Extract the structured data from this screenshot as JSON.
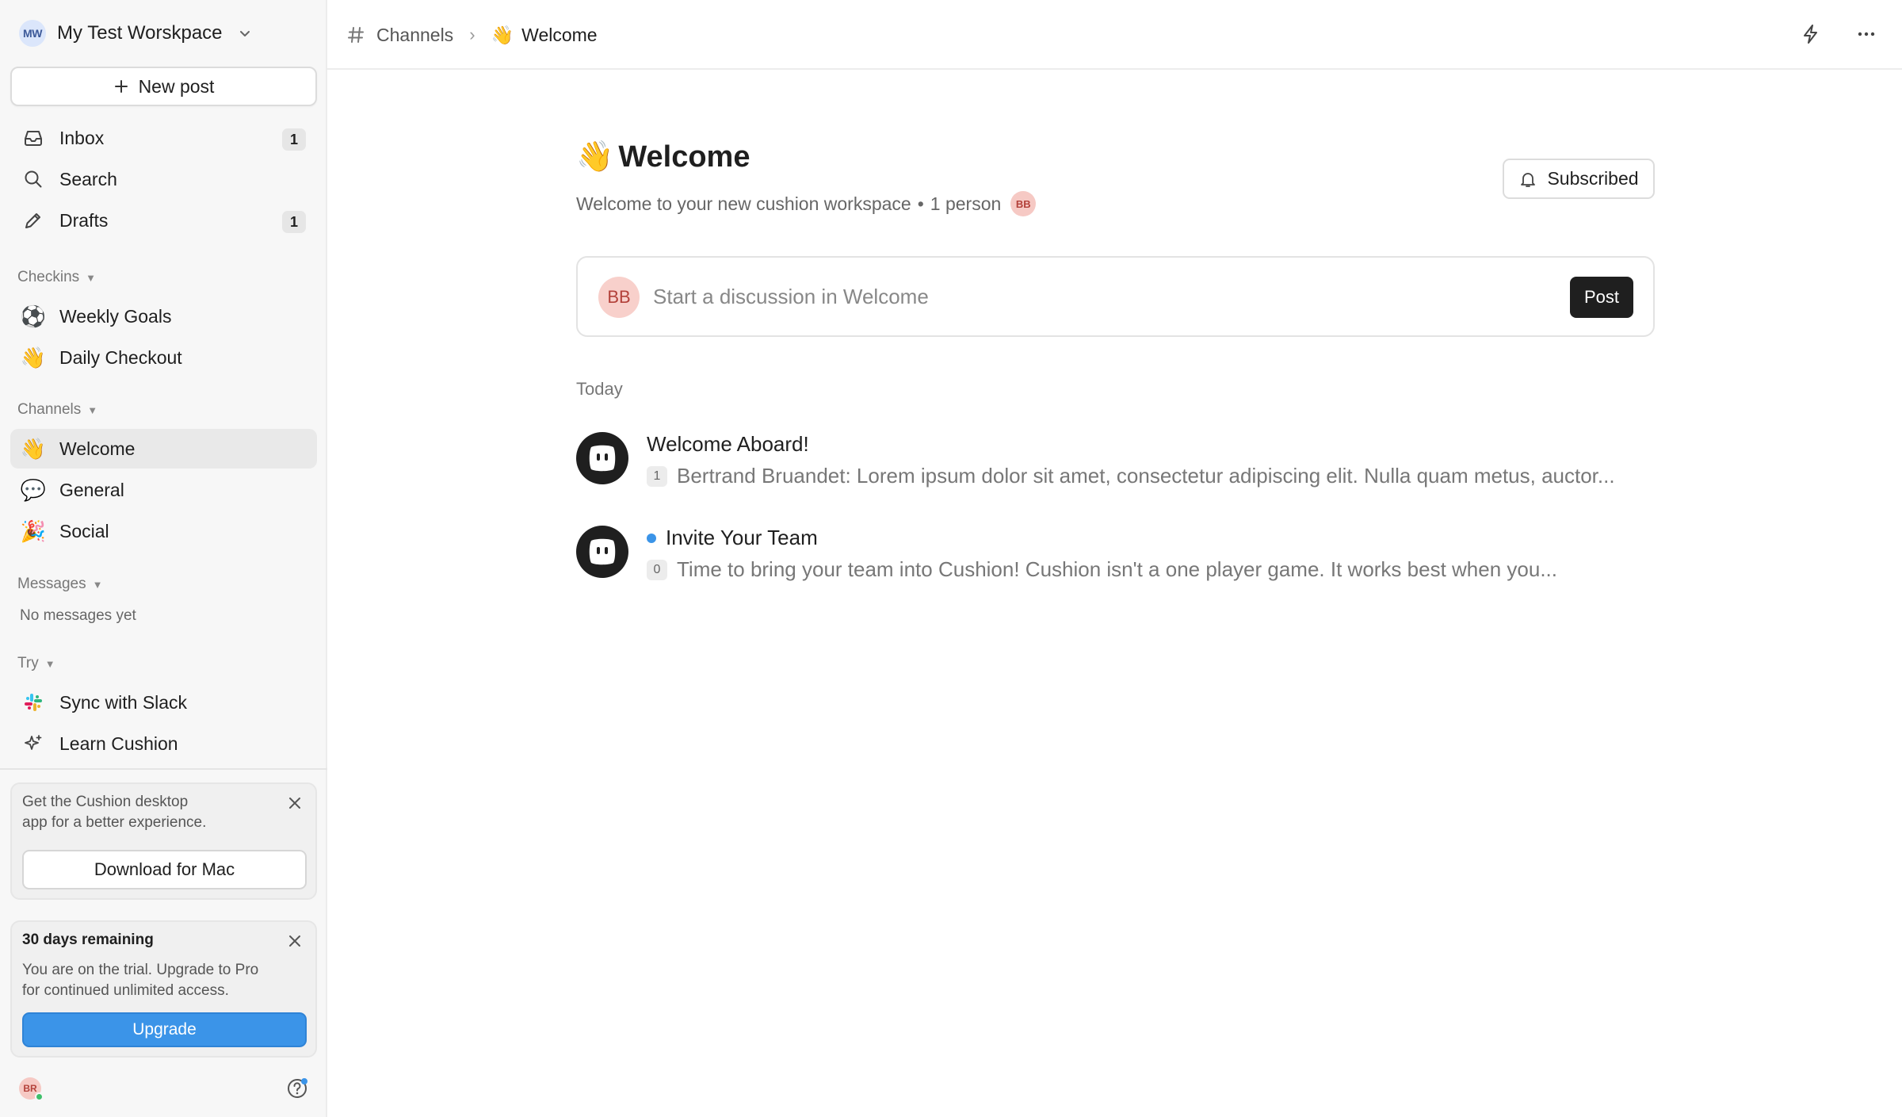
{
  "workspace": {
    "initials": "MW",
    "name": "My Test Worskpace"
  },
  "sidebar": {
    "new_post_label": "New post",
    "primary": [
      {
        "icon": "inbox-icon",
        "label": "Inbox",
        "badge": "1"
      },
      {
        "icon": "search-icon",
        "label": "Search"
      },
      {
        "icon": "pencil-icon",
        "label": "Drafts",
        "badge": "1"
      }
    ],
    "checkins_label": "Checkins",
    "checkins": [
      {
        "icon": "soccer-ball-icon",
        "emoji": "⚽",
        "label": "Weekly Goals"
      },
      {
        "icon": "waving-hand-icon",
        "emoji": "👋",
        "label": "Daily Checkout"
      }
    ],
    "channels_label": "Channels",
    "channels": [
      {
        "icon": "waving-hand-icon",
        "emoji": "👋",
        "label": "Welcome",
        "active": true
      },
      {
        "icon": "speech-bubble-icon",
        "emoji": "💬",
        "label": "General"
      },
      {
        "icon": "party-popper-icon",
        "emoji": "🎉",
        "label": "Social"
      }
    ],
    "messages_label": "Messages",
    "messages_empty": "No messages yet",
    "try_label": "Try",
    "try_items": [
      {
        "icon": "slack-icon",
        "label": "Sync with Slack"
      },
      {
        "icon": "sparkle-icon",
        "label": "Learn Cushion"
      }
    ],
    "desktop_promo": {
      "text_line1": "Get the Cushion desktop",
      "text_line2": "app for a better experience.",
      "button_label": "Download for Mac"
    },
    "trial": {
      "title": "30 days remaining",
      "text_line1": "You are on the trial. Upgrade to Pro",
      "text_line2": "for continued unlimited access.",
      "button_label": "Upgrade"
    },
    "user_initials": "BR"
  },
  "header": {
    "breadcrumb_root": "Channels",
    "breadcrumb_current": "Welcome",
    "breadcrumb_emoji": "👋"
  },
  "channel": {
    "emoji": "👋",
    "title": "Welcome",
    "description": "Welcome to your new cushion workspace",
    "member_count": "1 person",
    "member_initials": "BB",
    "subscribe_label": "Subscribed"
  },
  "composer": {
    "avatar_initials": "BB",
    "placeholder": "Start a discussion in Welcome",
    "post_label": "Post"
  },
  "feed": {
    "day_label": "Today",
    "posts": [
      {
        "title": "Welcome Aboard!",
        "count": "1",
        "preview": "Bertrand Bruandet: Lorem ipsum dolor sit amet, consectetur adipiscing elit. Nulla quam metus, auctor...",
        "unread": false
      },
      {
        "title": "Invite Your Team",
        "count": "0",
        "preview": "Time to bring your team into Cushion! Cushion isn't a one player game. It works best when you...",
        "unread": true
      }
    ]
  },
  "colors": {
    "accent": "#3b94e8",
    "sidebar_bg": "#f7f7f7",
    "post_button": "#1f1f1f"
  }
}
